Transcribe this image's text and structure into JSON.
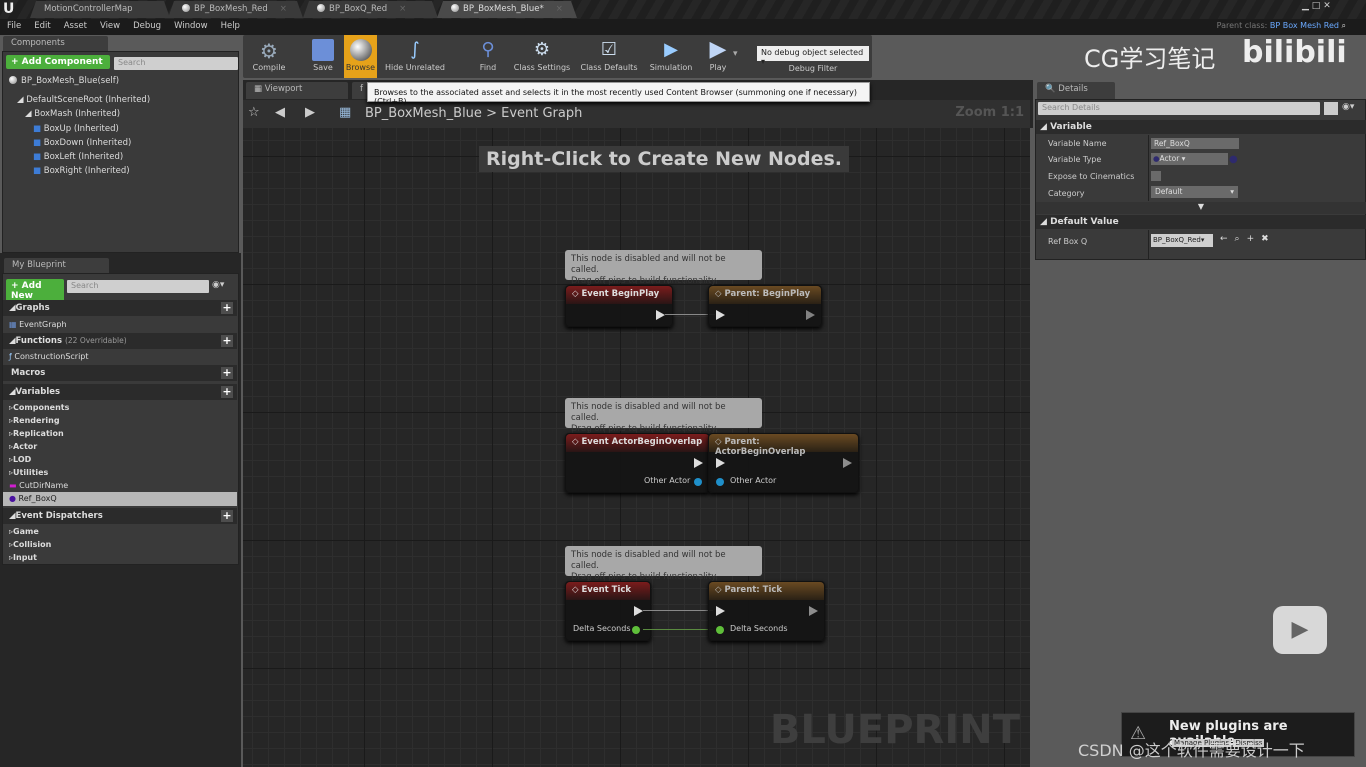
{
  "title_tabs": [
    {
      "label": "MotionControllerMap"
    },
    {
      "label": "BP_BoxMesh_Red"
    },
    {
      "label": "BP_BoxQ_Red"
    },
    {
      "label": "BP_BoxMesh_Blue*"
    }
  ],
  "menu": [
    "File",
    "Edit",
    "Asset",
    "View",
    "Debug",
    "Window",
    "Help"
  ],
  "parent_class": {
    "label": "Parent class:",
    "value": "BP Box Mesh Red"
  },
  "components": {
    "tab": "Components",
    "add_label": "+ Add Component",
    "search_placeholder": "Search",
    "self": "BP_BoxMesh_Blue(self)",
    "tree": [
      "DefaultSceneRoot (Inherited)",
      "BoxMash (Inherited)",
      "BoxUp (Inherited)",
      "BoxDown (Inherited)",
      "BoxLeft (Inherited)",
      "BoxRight (Inherited)"
    ]
  },
  "my_blueprint": {
    "tab": "My Blueprint",
    "add_label": "+ Add New",
    "search_placeholder": "Search",
    "graphs": {
      "label": "Graphs",
      "items": [
        "EventGraph"
      ]
    },
    "functions": {
      "label": "Functions",
      "count": "(22 Overridable)",
      "items": [
        "ConstructionScript"
      ]
    },
    "macros": {
      "label": "Macros"
    },
    "variables": {
      "label": "Variables",
      "categories": [
        "Components",
        "Rendering",
        "Replication",
        "Actor",
        "LOD",
        "Utilities"
      ],
      "items": [
        "CutDirName",
        "Ref_BoxQ"
      ]
    },
    "dispatchers": {
      "label": "Event Dispatchers",
      "categories": [
        "Game",
        "Collision",
        "Input"
      ]
    }
  },
  "toolbar": {
    "compile": "Compile",
    "save": "Save",
    "browse": "Browse",
    "hide_unrelated": "Hide Unrelated",
    "find": "Find",
    "class_settings": "Class Settings",
    "class_defaults": "Class Defaults",
    "simulation": "Simulation",
    "play": "Play",
    "debug_object": "No debug object selected",
    "debug_filter": "Debug Filter"
  },
  "tooltip": "Browses to the associated asset and selects it in the most recently used Content Browser (summoning one if necessary) (Ctrl+B)",
  "graph": {
    "tabs": [
      "Viewport",
      "f"
    ],
    "breadcrumb_root": "BP_BoxMesh_Blue",
    "breadcrumb_sep": ">",
    "breadcrumb_current": "Event Graph",
    "zoom": "Zoom 1:1",
    "hint": "Right-Click to Create New Nodes.",
    "watermark": "BLUEPRINT",
    "comment_line1": "This node is disabled and will not be called.",
    "comment_line2": "Drag off pins to build functionality.",
    "nodes": [
      {
        "event": "Event BeginPlay",
        "parent": "Parent: BeginPlay"
      },
      {
        "event": "Event ActorBeginOverlap",
        "parent": "Parent: ActorBeginOverlap",
        "pin": "Other Actor",
        "pin_color": "#1f8fc9"
      },
      {
        "event": "Event Tick",
        "parent": "Parent: Tick",
        "pin": "Delta Seconds",
        "pin_color": "#5fbf3a"
      }
    ]
  },
  "details": {
    "tab": "Details",
    "search_placeholder": "Search Details",
    "variable_section": "Variable",
    "variable_name_label": "Variable Name",
    "variable_name": "Ref_BoxQ",
    "variable_type_label": "Variable Type",
    "variable_type": "Actor",
    "expose_label": "Expose to Cinematics",
    "expose_checked": false,
    "category_label": "Category",
    "category": "Default",
    "default_section": "Default Value",
    "ref_label": "Ref Box Q",
    "ref_value": "BP_BoxQ_Red"
  },
  "notification": {
    "text": "New plugins are available",
    "button1": "Manage Plugins",
    "button2": "Dismiss"
  },
  "watermarks": {
    "brand": "CG学习笔记",
    "logo": "bilibili",
    "csdn": "CSDN @这个软件需要设计一下"
  }
}
